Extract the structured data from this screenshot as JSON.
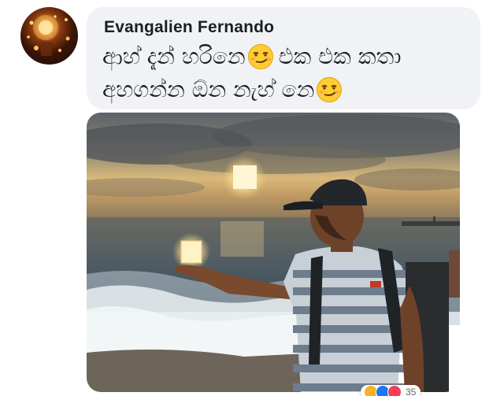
{
  "comment": {
    "author": "Evangalien Fernando",
    "line1_part1": "ආහ් දැන් හරිනෙ",
    "line1_part2": "එක එක කතා",
    "line2": "අහගන්න ඕන නැහ් නෙ",
    "emoji": "smirking-face-icon"
  },
  "avatar": {
    "icon": "avatar-lanterns"
  },
  "attachment": {
    "description_icon": "sunset-beach-photo"
  },
  "reactions": {
    "icons": [
      "haha-reaction-icon",
      "like-reaction-icon",
      "love-reaction-icon"
    ],
    "count": "35"
  },
  "colors": {
    "bubble": "#f0f2f5",
    "text": "#1c1e21",
    "like": "#1877f2",
    "love": "#f33e58",
    "haha": "#f7b125"
  }
}
